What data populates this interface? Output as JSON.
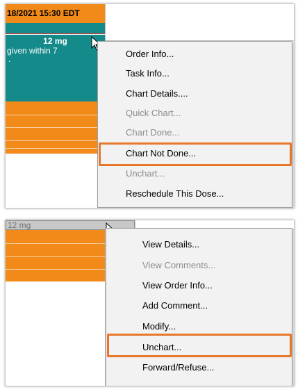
{
  "top_panel": {
    "header": "18/2021 15:30 EDT",
    "dose": "12 mg",
    "note_line1": "given within 7",
    "note_line2": ".",
    "menu": [
      {
        "label": "Order Info...",
        "disabled": false
      },
      {
        "label": "Task Info...",
        "disabled": false
      },
      {
        "label": "Chart Details....",
        "disabled": false
      },
      {
        "label": "Quick Chart...",
        "disabled": true
      },
      {
        "label": "Chart Done...",
        "disabled": true
      },
      {
        "label": "Chart Not Done...",
        "disabled": false,
        "highlighted": true
      },
      {
        "label": "Unchart...",
        "disabled": true
      },
      {
        "label": "Reschedule This Dose...",
        "disabled": false
      }
    ]
  },
  "bottom_panel": {
    "dose": "12 mg",
    "menu": [
      {
        "label": "View Details...",
        "disabled": false
      },
      {
        "label": "View Comments...",
        "disabled": true
      },
      {
        "label": "View Order Info...",
        "disabled": false
      },
      {
        "label": "Add Comment...",
        "disabled": false
      },
      {
        "label": "Modify...",
        "disabled": false
      },
      {
        "label": "Unchart...",
        "disabled": false,
        "highlighted": true
      },
      {
        "label": "Forward/Refuse...",
        "disabled": false
      }
    ]
  },
  "colors": {
    "teal": "#148a8b",
    "orange": "#f28a1a",
    "highlight": "#e8772a",
    "disabled_text": "#8c8c8c"
  }
}
